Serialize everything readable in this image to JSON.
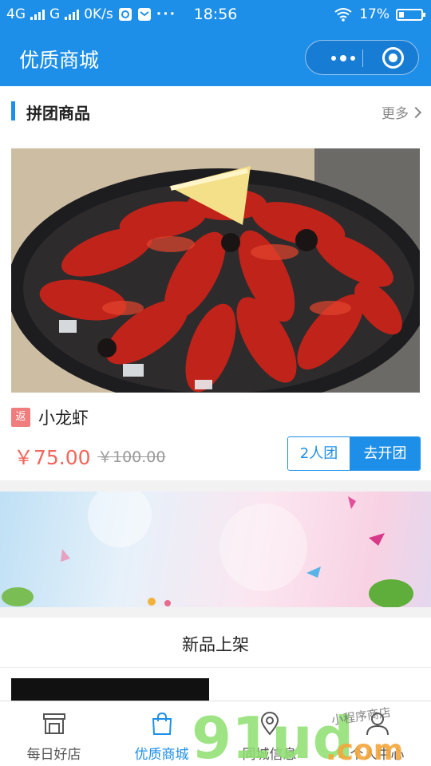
{
  "status_bar": {
    "network1": "4G",
    "network2": "G",
    "speed": "0K/s",
    "time": "18:56",
    "battery": "17%"
  },
  "header": {
    "title": "优质商城"
  },
  "group_section": {
    "title": "拼团商品",
    "more": "更多",
    "product": {
      "badge": "返",
      "name": "小龙虾",
      "price": "￥75.00",
      "original_price": "￥100.00",
      "group_size_button": "2人团",
      "open_group_button": "去开团"
    }
  },
  "new_section": {
    "title": "新品上架"
  },
  "tabbar": {
    "items": [
      {
        "label": "每日好店",
        "icon": "store-icon"
      },
      {
        "label": "优质商城",
        "icon": "shopping-bag-icon"
      },
      {
        "label": "同城信息",
        "icon": "location-pin-icon"
      },
      {
        "label": "个人中心",
        "icon": "user-icon"
      }
    ],
    "active_index": 1
  },
  "watermark": {
    "brand": "91ud",
    "domain": ".com",
    "handwriting": "小程序商店"
  },
  "colors": {
    "primary": "#1e8fe8",
    "price": "#f2665c",
    "badge": "#f07d7d"
  }
}
